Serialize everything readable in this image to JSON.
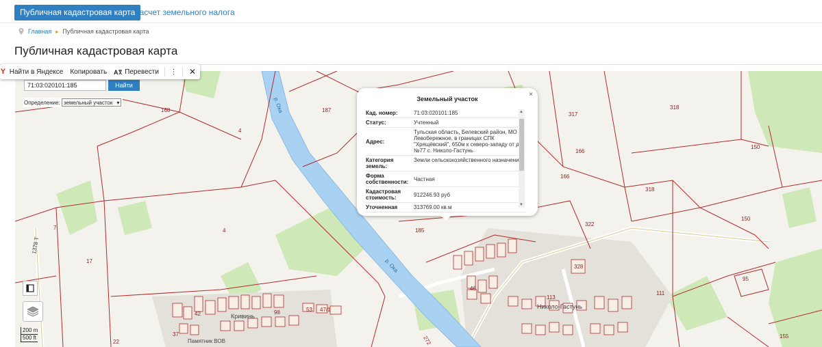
{
  "tabs": {
    "active": "Публичная кадастровая карта",
    "second": "Расчет земельного налога"
  },
  "breadcrumb": {
    "home": "Главная",
    "current": "Публичная кадастровая карта"
  },
  "page_title": "Публичная кадастровая карта",
  "yandex_toolbar": {
    "logo": "Y",
    "find": "Найти в Яндексе",
    "copy": "Копировать",
    "translate": "Перевести",
    "more": "⋮",
    "close": "✕"
  },
  "search": {
    "value": "71:03:020101:185",
    "button": "Найти",
    "definition_label": "Определение:",
    "definition_value": "земельный участок"
  },
  "scale": {
    "metric": "200 m",
    "imperial": "500 ft"
  },
  "popup": {
    "title": "Земельный участок",
    "close": "×",
    "rows": [
      {
        "key": "Кад. номер:",
        "value": "71:03:020101:185"
      },
      {
        "key": "Статус:",
        "value": "Учтенный"
      },
      {
        "key": "Адрес:",
        "value": "Тульская область, Белевский район, МО Левобережное, в границах СПК \"Хрящёвский\", 650м к северо-западу от д. №77 с. Николо-Гастунь"
      },
      {
        "key": "Категория земель:",
        "value": "Земли сельскохозяйственного назначения"
      },
      {
        "key": "Форма собственности:",
        "value": "Частная"
      },
      {
        "key": "Кадастровая стоимость:",
        "value": "912246.93 руб"
      },
      {
        "key": "Уточненная площадь:",
        "value": "313769.00 кв.м"
      }
    ]
  },
  "map_labels": {
    "p168": "168",
    "p4a": "4",
    "p187": "187",
    "p317": "317",
    "p318a": "318",
    "p166a": "166",
    "p166b": "166",
    "p150a": "150",
    "p318b": "318",
    "p322": "322",
    "p150b": "150",
    "p4b": "4",
    "p185": "185",
    "p7": "7",
    "p17": "17",
    "p22": "22",
    "p95": "95",
    "p155": "155",
    "p328": "328",
    "p272": "272",
    "p42": "42",
    "p53": "53",
    "p47": "47/1",
    "p98": "98",
    "p37": "37",
    "p46": "46",
    "p113": "113",
    "p111": "111",
    "road": "1378 Т",
    "river1": "р. Ока",
    "river2": "р. Ока",
    "village1": "Кривинь",
    "village2": "Николо-Гастунь",
    "memorial": "Памятник ВОВ"
  },
  "colors": {
    "accent": "#2f7fc1",
    "parcel_border": "#b22a2a",
    "river": "#a7d0f0",
    "green": "#cde8b4"
  }
}
